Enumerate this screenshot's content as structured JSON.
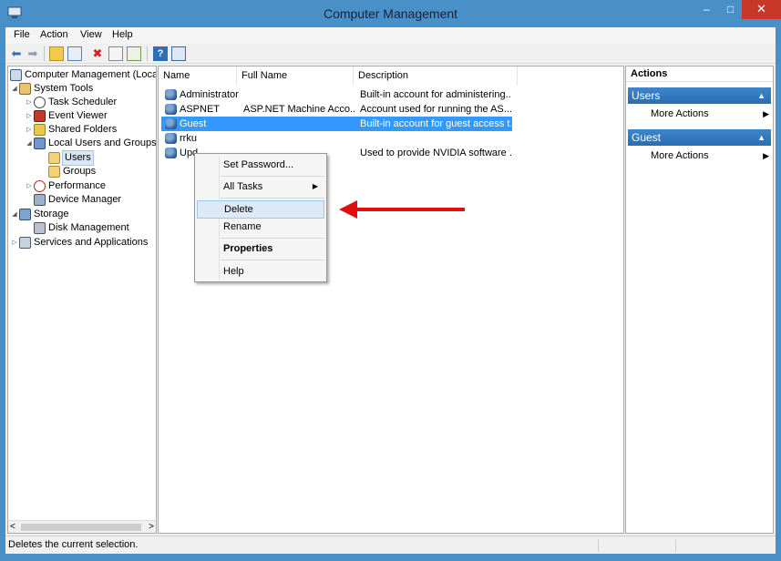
{
  "window": {
    "title": "Computer Management",
    "minimize": "–",
    "maximize": "□",
    "close": "✕"
  },
  "menu": [
    "File",
    "Action",
    "View",
    "Help"
  ],
  "toolbar": {
    "icons": [
      "back-arrow-icon",
      "forward-arrow-icon",
      "up-folder-icon",
      "show-hide-tree-icon",
      "delete-icon",
      "properties-icon",
      "export-list-icon",
      "help-icon",
      "console-icon"
    ]
  },
  "tree": {
    "items": [
      {
        "label": "Computer Management (Local",
        "expander": "",
        "icon": "computer-icon"
      },
      {
        "label": "System Tools",
        "expander": "◢",
        "icon": "tools-icon"
      },
      {
        "label": "Task Scheduler",
        "expander": "▷",
        "icon": "clock-icon"
      },
      {
        "label": "Event Viewer",
        "expander": "▷",
        "icon": "event-viewer-icon"
      },
      {
        "label": "Shared Folders",
        "expander": "▷",
        "icon": "shared-folder-icon"
      },
      {
        "label": "Local Users and Groups",
        "expander": "◢",
        "icon": "users-icon"
      },
      {
        "label": "Users",
        "expander": "",
        "icon": "folder-icon"
      },
      {
        "label": "Groups",
        "expander": "",
        "icon": "folder-icon"
      },
      {
        "label": "Performance",
        "expander": "▷",
        "icon": "performance-icon"
      },
      {
        "label": "Device Manager",
        "expander": "",
        "icon": "device-manager-icon"
      },
      {
        "label": "Storage",
        "expander": "◢",
        "icon": "storage-icon"
      },
      {
        "label": "Disk Management",
        "expander": "",
        "icon": "disk-icon"
      },
      {
        "label": "Services and Applications",
        "expander": "▷",
        "icon": "services-icon"
      }
    ],
    "scroll_left": "<",
    "scroll_right": ">"
  },
  "list": {
    "columns": [
      "Name",
      "Full Name",
      "Description"
    ],
    "rows": [
      {
        "name": "Administrator",
        "full_name": "",
        "description": "Built-in account for administering..."
      },
      {
        "name": "ASPNET",
        "full_name": "ASP.NET Machine Acco...",
        "description": "Account used for running the AS..."
      },
      {
        "name": "Guest",
        "full_name": "",
        "description": "Built-in account for guest access t..."
      },
      {
        "name": "rrku",
        "full_name": "",
        "description": ""
      },
      {
        "name": "Upd",
        "full_name": "",
        "description": "Used to provide NVIDIA software ..."
      }
    ]
  },
  "context_menu": {
    "items": [
      {
        "label": "Set Password...",
        "bold": false,
        "submenu": false
      },
      {
        "label": "All Tasks",
        "bold": false,
        "submenu": true
      },
      {
        "label": "Delete",
        "bold": false,
        "submenu": false
      },
      {
        "label": "Rename",
        "bold": false,
        "submenu": false
      },
      {
        "label": "Properties",
        "bold": true,
        "submenu": false
      },
      {
        "label": "Help",
        "bold": false,
        "submenu": false
      }
    ],
    "submenu_glyph": "▶"
  },
  "actions": {
    "header": "Actions",
    "sections": [
      {
        "title": "Users",
        "item": "More Actions"
      },
      {
        "title": "Guest",
        "item": "More Actions"
      }
    ],
    "caret": "▲",
    "more_glyph": "▶"
  },
  "status": {
    "text": "Deletes the current selection."
  },
  "colors": {
    "title_bar": "#4a90c8",
    "selection": "#3399ff",
    "section_header": "#2a6db4",
    "annotation_arrow": "#e01010",
    "close_button": "#c7382b"
  }
}
